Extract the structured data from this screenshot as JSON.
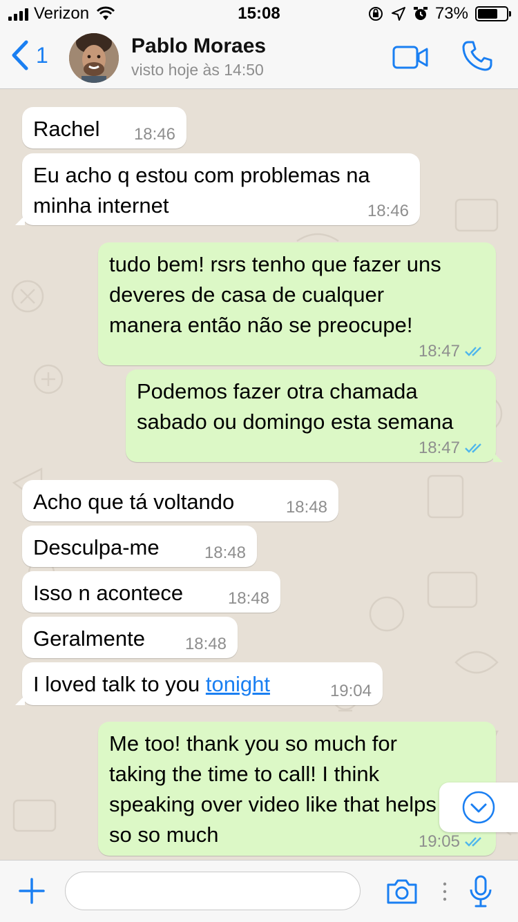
{
  "status_bar": {
    "carrier": "Verizon",
    "time": "15:08",
    "battery_percent": "73%",
    "battery_level": 0.73
  },
  "header": {
    "back_count": "1",
    "contact_name": "Pablo Moraes",
    "last_seen": "visto hoje às 14:50"
  },
  "messages": [
    {
      "direction": "in",
      "text": "Rachel",
      "time": "18:46"
    },
    {
      "direction": "in",
      "lines": [
        "Eu acho q estou com problemas na",
        "minha internet"
      ],
      "time": "18:46"
    },
    {
      "direction": "out",
      "lines": [
        "tudo bem! rsrs tenho que fazer uns",
        "deveres de casa de cualquer",
        "manera então não se preocupe!"
      ],
      "time": "18:47"
    },
    {
      "direction": "out",
      "lines": [
        "Podemos fazer otra chamada",
        "sabado ou domingo esta semana"
      ],
      "time": "18:47"
    },
    {
      "direction": "in",
      "text": "Acho que tá voltando",
      "time": "18:48"
    },
    {
      "direction": "in",
      "text": "Desculpa-me",
      "time": "18:48"
    },
    {
      "direction": "in",
      "text": "Isso n acontece",
      "time": "18:48"
    },
    {
      "direction": "in",
      "text": "Geralmente",
      "time": "18:48"
    },
    {
      "direction": "in",
      "text_before_link": "I loved talk to you ",
      "link_text": "tonight",
      "time": "19:04"
    },
    {
      "direction": "out",
      "lines": [
        "Me too! thank you so much for",
        "taking the time to call!  I think",
        "speaking over video like that helps",
        "so so much"
      ],
      "time": "19:05"
    }
  ],
  "input": {
    "placeholder": "",
    "value": ""
  },
  "icons": {
    "back": "chevron-left-icon",
    "video": "video-call-icon",
    "phone": "phone-icon",
    "add": "plus-icon",
    "camera": "camera-icon",
    "mic": "microphone-icon",
    "scroll": "chevron-down-icon",
    "read_receipt": "double-check-icon"
  },
  "colors": {
    "accent": "#1a7ff2",
    "outgoing_bubble": "#dcf8c6",
    "incoming_bubble": "#ffffff",
    "chat_background": "#e7e0d6",
    "read_ticks": "#4fb6ec"
  }
}
